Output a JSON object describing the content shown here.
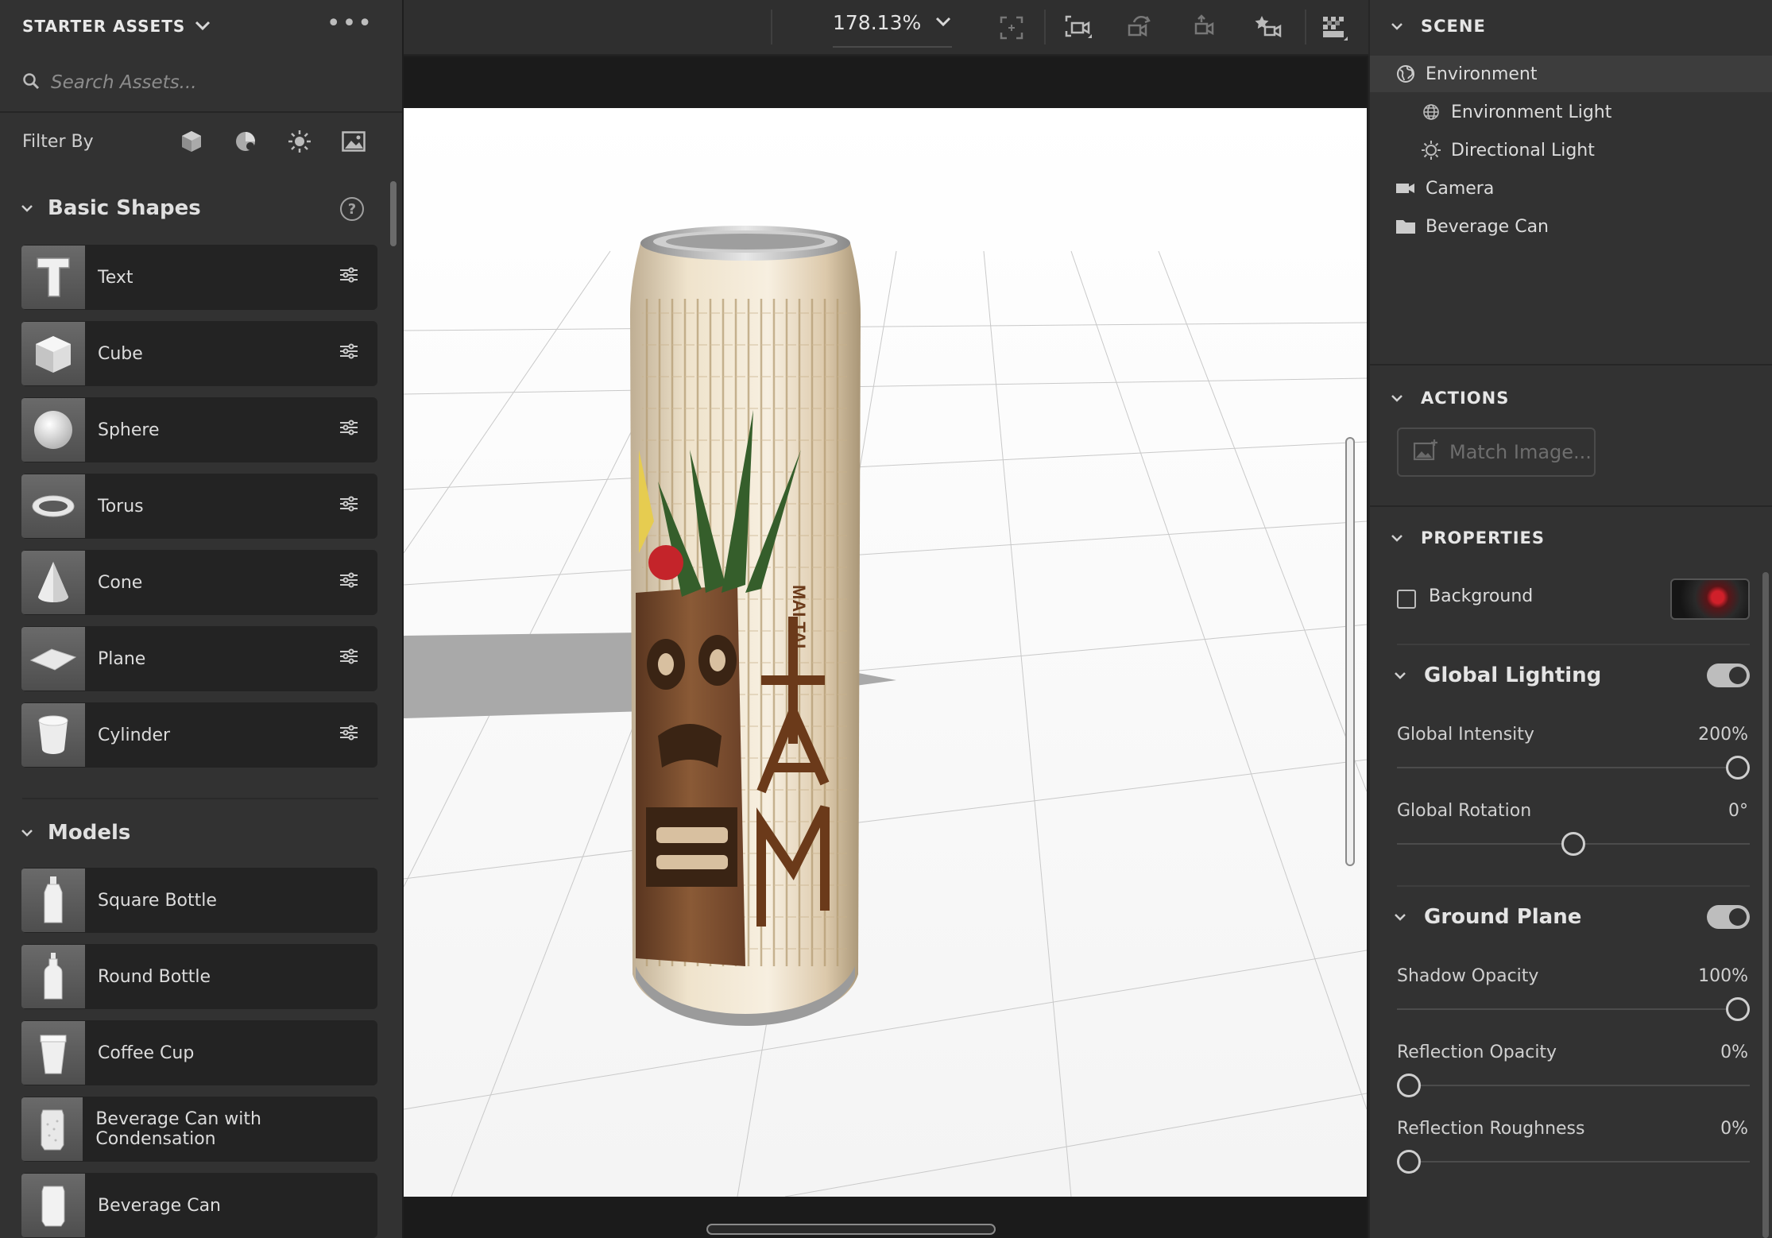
{
  "left_panel": {
    "title": "STARTER ASSETS",
    "search_placeholder": "Search Assets...",
    "filter_label": "Filter By",
    "filter_icons": [
      "cube-icon",
      "material-icon",
      "light-icon",
      "image-icon"
    ],
    "basic_shapes": {
      "label": "Basic Shapes",
      "items": [
        {
          "label": "Text",
          "icon": "text-shape-icon"
        },
        {
          "label": "Cube",
          "icon": "cube-shape-icon"
        },
        {
          "label": "Sphere",
          "icon": "sphere-shape-icon"
        },
        {
          "label": "Torus",
          "icon": "torus-shape-icon"
        },
        {
          "label": "Cone",
          "icon": "cone-shape-icon"
        },
        {
          "label": "Plane",
          "icon": "plane-shape-icon"
        },
        {
          "label": "Cylinder",
          "icon": "cylinder-shape-icon"
        }
      ]
    },
    "models": {
      "label": "Models",
      "items": [
        {
          "label": "Square Bottle"
        },
        {
          "label": "Round Bottle"
        },
        {
          "label": "Coffee Cup"
        },
        {
          "label": "Beverage Can with Condensation"
        },
        {
          "label": "Beverage Can"
        }
      ]
    }
  },
  "toolbar": {
    "zoom": "178.13%",
    "icons": [
      "frame-select-icon",
      "camera-frame-icon",
      "camera-rotate-icon",
      "camera-move-icon",
      "camera-star-icon",
      "render-grid-icon"
    ]
  },
  "canvas": {
    "can_text": "MAI TAI"
  },
  "right_panel": {
    "scene": {
      "label": "SCENE",
      "items": [
        {
          "label": "Environment",
          "icon": "globe-icon"
        },
        {
          "label": "Environment Light",
          "icon": "globe-grid-icon"
        },
        {
          "label": "Directional Light",
          "icon": "sun-icon"
        },
        {
          "label": "Camera",
          "icon": "video-camera-icon"
        },
        {
          "label": "Beverage Can",
          "icon": "folder-icon"
        }
      ]
    },
    "actions": {
      "label": "ACTIONS",
      "match_image": "Match Image..."
    },
    "properties": {
      "label": "PROPERTIES",
      "background_label": "Background",
      "background_checked": false,
      "global_lighting": {
        "label": "Global Lighting",
        "enabled": true,
        "intensity": {
          "label": "Global Intensity",
          "value": "200%",
          "level": 1.0
        },
        "rotation": {
          "label": "Global Rotation",
          "value": "0°",
          "level": 0.5
        }
      },
      "ground_plane": {
        "label": "Ground Plane",
        "enabled": true,
        "shadow_opacity": {
          "label": "Shadow Opacity",
          "value": "100%",
          "level": 1.0
        },
        "reflection_opacity": {
          "label": "Reflection Opacity",
          "value": "0%",
          "level": 0.0
        },
        "reflection_roughness": {
          "label": "Reflection Roughness",
          "value": "0%",
          "level": 0.0
        }
      }
    }
  }
}
